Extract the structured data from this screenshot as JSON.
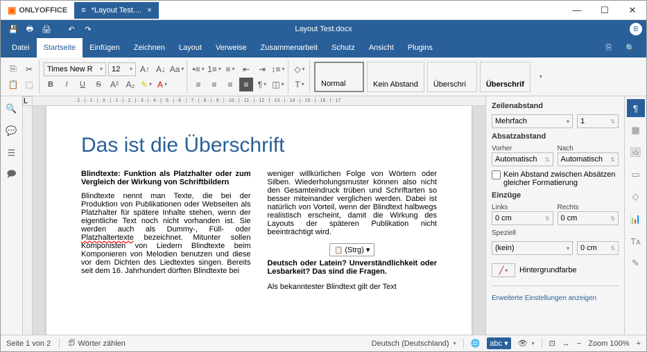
{
  "app": "ONLYOFFICE",
  "tab_name": "*Layout Test....",
  "doc_title": "Layout Test.docx",
  "user_initial": "B",
  "menu": {
    "datei": "Datei",
    "startseite": "Startseite",
    "einfuegen": "Einfügen",
    "zeichnen": "Zeichnen",
    "layout": "Layout",
    "verweise": "Verweise",
    "zusammenarbeit": "Zusammenarbeit",
    "schutz": "Schutz",
    "ansicht": "Ansicht",
    "plugins": "Plugins"
  },
  "font": {
    "name": "Times New R",
    "size": "12"
  },
  "styles": {
    "normal": "Normal",
    "kein_abstand": "Kein Abstand",
    "ueber1": "Überschri",
    "ueber2": "Überschrif"
  },
  "ruler": "· 2 · | · 1 · | · X · | · 1 · | · 2 · | · 3 · | · 4 · | · 5 · | · 6 · | · 7 · | · 8 · | · 9 · | · 10 · | · 11 · | · 12 · | · 13 · | · 14 · | · 15 · | · 16 · | · 17",
  "document": {
    "heading": "Das ist die Überschrift",
    "subhead": "Blindtexte: Funktion als Platzhalter oder zum Vergleich der Wirkung von Schriftbildern",
    "p1a": "Blindtexte nennt man Texte, die bei der Produktion von Publikationen oder Webseiten als Platzhalter für spätere Inhalte stehen, wenn der eigentliche Text noch nicht vorhanden ist. Sie werden auch als Dummy-, Füll- oder ",
    "p1u": "Platzhaltertexte",
    "p1b": " bezeichnet. Mitunter sollen Komponisten von Liedern Blindtexte beim Komponieren von Melodien benutzen und diese vor dem Dichten des Liedtextes singen. Bereits seit dem 16. Jahrhundert dürften Blindtexte bei ",
    "p2": "weniger willkürlichen Folge von Wörtern oder Silben. Wiederholungsmuster können also nicht den Gesamteindruck trüben und Schriftarten so besser miteinander verglichen werden. Dabei ist natürlich von Vorteil, wenn der Blindtext halbwegs realistisch erscheint, damit die Wirkung des Layouts der späteren Publikation nicht beeinträchtigt wird.",
    "paste_hint": "(Strg) ▾",
    "p3": "Deutsch oder Latein? Unverständlichkeit oder Lesbarkeit? Das sind die Fragen.",
    "p4": "Als bekanntester Blindtext gilt der Text"
  },
  "right_panel": {
    "zeilenabstand": "Zeilenabstand",
    "mehrfach": "Mehrfach",
    "spacing_val": "1",
    "absatzabstand": "Absatzabstand",
    "vorher": "Vorher",
    "nach": "Nach",
    "auto": "Automatisch",
    "checkbox": "Kein Abstand zwischen Absätzen gleicher Formatierung",
    "einzuege": "Einzüge",
    "links": "Links",
    "rechts": "Rechts",
    "zero": "0 cm",
    "speziell": "Speziell",
    "kein": "(kein)",
    "bg": "Hintergrundfarbe",
    "advanced": "Erweiterte Einstellungen anzeigen"
  },
  "status": {
    "page": "Seite 1 von 2",
    "words": "Wörter zählen",
    "lang": "Deutsch (Deutschland)",
    "zoom": "Zoom 100%"
  }
}
